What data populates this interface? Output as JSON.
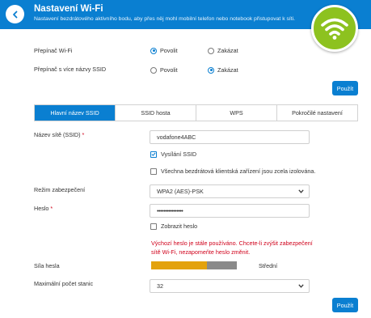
{
  "header": {
    "title": "Nastavení Wi-Fi",
    "subtitle": "Nastavení bezdrátového aktivního bodu, aby přes něj mohl mobilní telefon nebo notebook přistupovat k síti.",
    "back_icon": "chevron-left-icon",
    "badge_icon": "wifi-icon",
    "accent_color": "#0a7fd1",
    "badge_color": "#8dc21f"
  },
  "wifi_switch": {
    "label": "Přepínač Wi-Fi",
    "options": [
      "Povolit",
      "Zakázat"
    ],
    "selected": "Povolit"
  },
  "multi_ssid": {
    "label": "Přepínač s více názvy SSID",
    "options": [
      "Povolit",
      "Zakázat"
    ],
    "selected": "Zakázat"
  },
  "apply_top": "Použít",
  "tabs": [
    "Hlavní název SSID",
    "SSID hosta",
    "WPS",
    "Pokročilé nastavení"
  ],
  "active_tab": "Hlavní název SSID",
  "form": {
    "ssid_label": "Název sítě (SSID)",
    "required_mark": "*",
    "ssid_value": "vodafone4ABC",
    "broadcast_label": "Vysílání SSID",
    "broadcast_checked": true,
    "isolation_label": "Všechna bezdrátová klientská zařízení jsou zcela izolována.",
    "isolation_checked": false,
    "security_label": "Režim zabezpečení",
    "security_value": "WPA2 (AES)-PSK",
    "password_label": "Heslo",
    "password_value": "••••••••••••••••",
    "show_password_label": "Zobrazit heslo",
    "show_password_checked": false,
    "warning": "Výchozí heslo je stále používáno. Chcete-li zvýšit zabezpečení sítě Wi-Fi, nezapomeňte heslo změnit.",
    "strength_label": "Síla hesla",
    "strength_text": "Střední",
    "strength_fraction": 0.65,
    "max_stations_label": "Maximální počet stanic",
    "max_stations_value": "32"
  },
  "apply_bottom": "Použít"
}
